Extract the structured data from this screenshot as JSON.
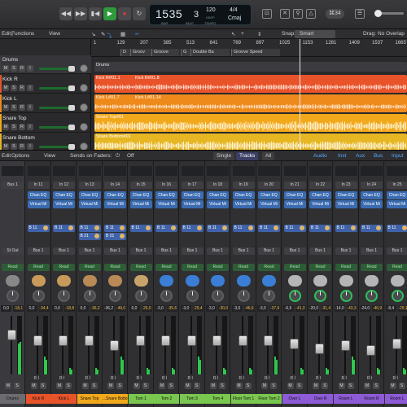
{
  "colors": {
    "accent_blue": "#3a94ff",
    "region_red": "#e8532a",
    "region_orange": "#ee8a1c",
    "region_yellow": "#f2a81b",
    "region_gold": "#e6b623",
    "play_green": "#2f9a3c",
    "meter_green": "#2fc84e"
  },
  "control_bar": {
    "transport": [
      "rewind-icon",
      "fast-forward-icon",
      "go-to-start-icon",
      "play-icon",
      "record-icon",
      "cycle-icon"
    ],
    "lcd": {
      "position": "1535",
      "beat": "3",
      "bar_label": "BAR",
      "beat_label": "BEAT",
      "tempo": "120",
      "tempo_sub": "KEEP",
      "tempo_label": "TEMPO",
      "signature": "4/4",
      "key": "Cmaj"
    },
    "right": {
      "count_in": "⌘34"
    }
  },
  "tracks_toolbar": {
    "edit": "Edit",
    "functions": "Functions",
    "view": "View",
    "snap_label": "Snap:",
    "snap_value": "Smart",
    "drag_label": "Drag:",
    "drag_value": "No Overlap"
  },
  "track_headers": [
    {
      "name": "Drums"
    },
    {
      "name": "Kick R"
    },
    {
      "name": "Kick L"
    },
    {
      "name": "Snare Top"
    },
    {
      "name": "Snare Bottom"
    }
  ],
  "ruler": {
    "bars": [
      "1",
      "129",
      "207",
      "385",
      "513",
      "641",
      "769",
      "897",
      "1025",
      "1153",
      "1281",
      "1409",
      "1537",
      "1665"
    ],
    "markers": [
      "D",
      "Groov",
      "Groove",
      "G",
      "Double Ba",
      "Groove Speed"
    ]
  },
  "regions": {
    "drums_folder": "Drums",
    "kick_r_1": "Kick R#01.1",
    "kick_r_2": "Kick R#01.8",
    "kick_l_1": "Kick L#01.7",
    "kick_l_2": "Kick L#01.14",
    "snare_top": "Snare Top#01",
    "snare_bottom": "Snare Bottom#01"
  },
  "mixer_toolbar": {
    "edit": "Edit",
    "options": "Options",
    "view": "View",
    "sends_on_faders": "Sends on Faders:",
    "sends_value": "Off",
    "single": "Single",
    "tracks": "Tracks",
    "all": "All",
    "filters": [
      "Audio",
      "Inst",
      "Aux",
      "Bus",
      "Input"
    ]
  },
  "strips": [
    {
      "input": "Bus 1",
      "plugins": [],
      "sends": [],
      "output": "St Out",
      "db_l": "0,0",
      "db_r": "-18,1",
      "name": "Drums",
      "color": "#6c6c70",
      "icon": "#888"
    },
    {
      "input": "In 11",
      "plugins": [
        "Chan EQ",
        "Virtual Mi"
      ],
      "sends": [
        "B 11"
      ],
      "output": "Bus 1",
      "db_l": "0,0",
      "db_r": "-34,4",
      "name": "Kick R",
      "color": "#e8532a",
      "icon": "#c89a5a"
    },
    {
      "input": "In 12",
      "plugins": [
        "Chan EQ",
        "Virtual Mi"
      ],
      "sends": [
        "B 11"
      ],
      "output": "Bus 1",
      "db_l": "0,0",
      "db_r": "-18,8",
      "name": "Kick L",
      "color": "#e8532a",
      "icon": "#c89a5a"
    },
    {
      "input": "In 13",
      "plugins": [
        "Chan EQ",
        "Virtual Mi"
      ],
      "sends": [
        "B 11",
        "B 21"
      ],
      "output": "Bus 1",
      "db_l": "0,0",
      "db_r": "-36,2",
      "name": "Snare Top",
      "color": "#f2a81b",
      "icon": "#b98a56"
    },
    {
      "input": "In 14",
      "plugins": [
        "Chan EQ",
        "Virtual Mi"
      ],
      "sends": [
        "B 11",
        "B 21"
      ],
      "output": "Bus 1",
      "db_l": "-36,2",
      "db_r": "-49,0",
      "name": "...Snare Bottom",
      "color": "#f2a81b",
      "icon": "#b98a56"
    },
    {
      "input": "In 15",
      "plugins": [
        "Chan EQ",
        "Virtual Mi"
      ],
      "sends": [
        "B 11"
      ],
      "output": "Bus 1",
      "db_l": "0,0",
      "db_r": "-26,0",
      "name": "Tom 1",
      "color": "#7ac74f",
      "icon": "#c9a46a"
    },
    {
      "input": "In 16",
      "plugins": [
        "Chan EQ",
        "Virtual Mi"
      ],
      "sends": [
        "B 11"
      ],
      "output": "Bus 1",
      "db_l": "-3,0",
      "db_r": "-35,6",
      "name": "Tom 2",
      "color": "#7ac74f",
      "icon": "#3a7fd5"
    },
    {
      "input": "In 17",
      "plugins": [
        "Chan EQ",
        "Virtual Mi"
      ],
      "sends": [
        "B 11"
      ],
      "output": "Bus 1",
      "db_l": "-3,0",
      "db_r": "-29,4",
      "name": "Tom 3",
      "color": "#7ac74f",
      "icon": "#3a7fd5"
    },
    {
      "input": "In 18",
      "plugins": [
        "Chan EQ",
        "Virtual Mi"
      ],
      "sends": [
        "B 11"
      ],
      "output": "Bus 1",
      "db_l": "-3,0",
      "db_r": "-30,0",
      "name": "Tom 4",
      "color": "#7ac74f",
      "icon": "#3a7fd5"
    },
    {
      "input": "In 19",
      "plugins": [
        "Chan EQ",
        "Virtual Mi"
      ],
      "sends": [
        "B 11"
      ],
      "output": "Bus 1",
      "db_l": "-3,0",
      "db_r": "-46,6",
      "name": "Floor Tom 1",
      "color": "#7ac74f",
      "icon": "#3a7fd5"
    },
    {
      "input": "In 20",
      "plugins": [
        "Chan EQ",
        "Virtual Mi"
      ],
      "sends": [
        "B 11"
      ],
      "output": "Bus 1",
      "db_l": "-3,0",
      "db_r": "-37,9",
      "name": "Floor Tom 2",
      "color": "#7ac74f",
      "icon": "#3a7fd5"
    },
    {
      "input": "In 21",
      "plugins": [
        "Chan EQ",
        "Virtual Mi"
      ],
      "sends": [
        "B 11"
      ],
      "output": "Bus 1",
      "db_l": "-6,5",
      "db_r": "-41,0",
      "name": "Over L",
      "color": "#8d5bd6",
      "icon": "#b5b5b5"
    },
    {
      "input": "In 22",
      "plugins": [
        "Chan EQ",
        "Virtual Mi"
      ],
      "sends": [
        "B 11"
      ],
      "output": "Bus 1",
      "db_l": "-20,0",
      "db_r": "-31,4",
      "name": "Over R",
      "color": "#8d5bd6",
      "icon": "#b5b5b5"
    },
    {
      "input": "In 23",
      "plugins": [
        "Chan EQ",
        "Virtual Mi"
      ],
      "sends": [
        "B 11"
      ],
      "output": "Bus 1",
      "db_l": "-14,0",
      "db_r": "-43,3",
      "name": "Room L",
      "color": "#8d5bd6",
      "icon": "#b5b5b5"
    },
    {
      "input": "In 24",
      "plugins": [
        "Chan EQ",
        "Virtual Mi"
      ],
      "sends": [
        "B 11"
      ],
      "output": "Bus 1",
      "db_l": "-24,0",
      "db_r": "-46,9",
      "name": "Room R",
      "color": "#8d5bd6",
      "icon": "#b5b5b5"
    },
    {
      "input": "In 25",
      "plugins": [
        "Chan EQ",
        "Virtual Mi"
      ],
      "sends": [
        "B 11"
      ],
      "output": "Bus 1",
      "db_l": "-8,4",
      "db_r": "-29,1",
      "name": "Room L",
      "color": "#8d5bd6",
      "icon": "#b5b5b5"
    }
  ]
}
